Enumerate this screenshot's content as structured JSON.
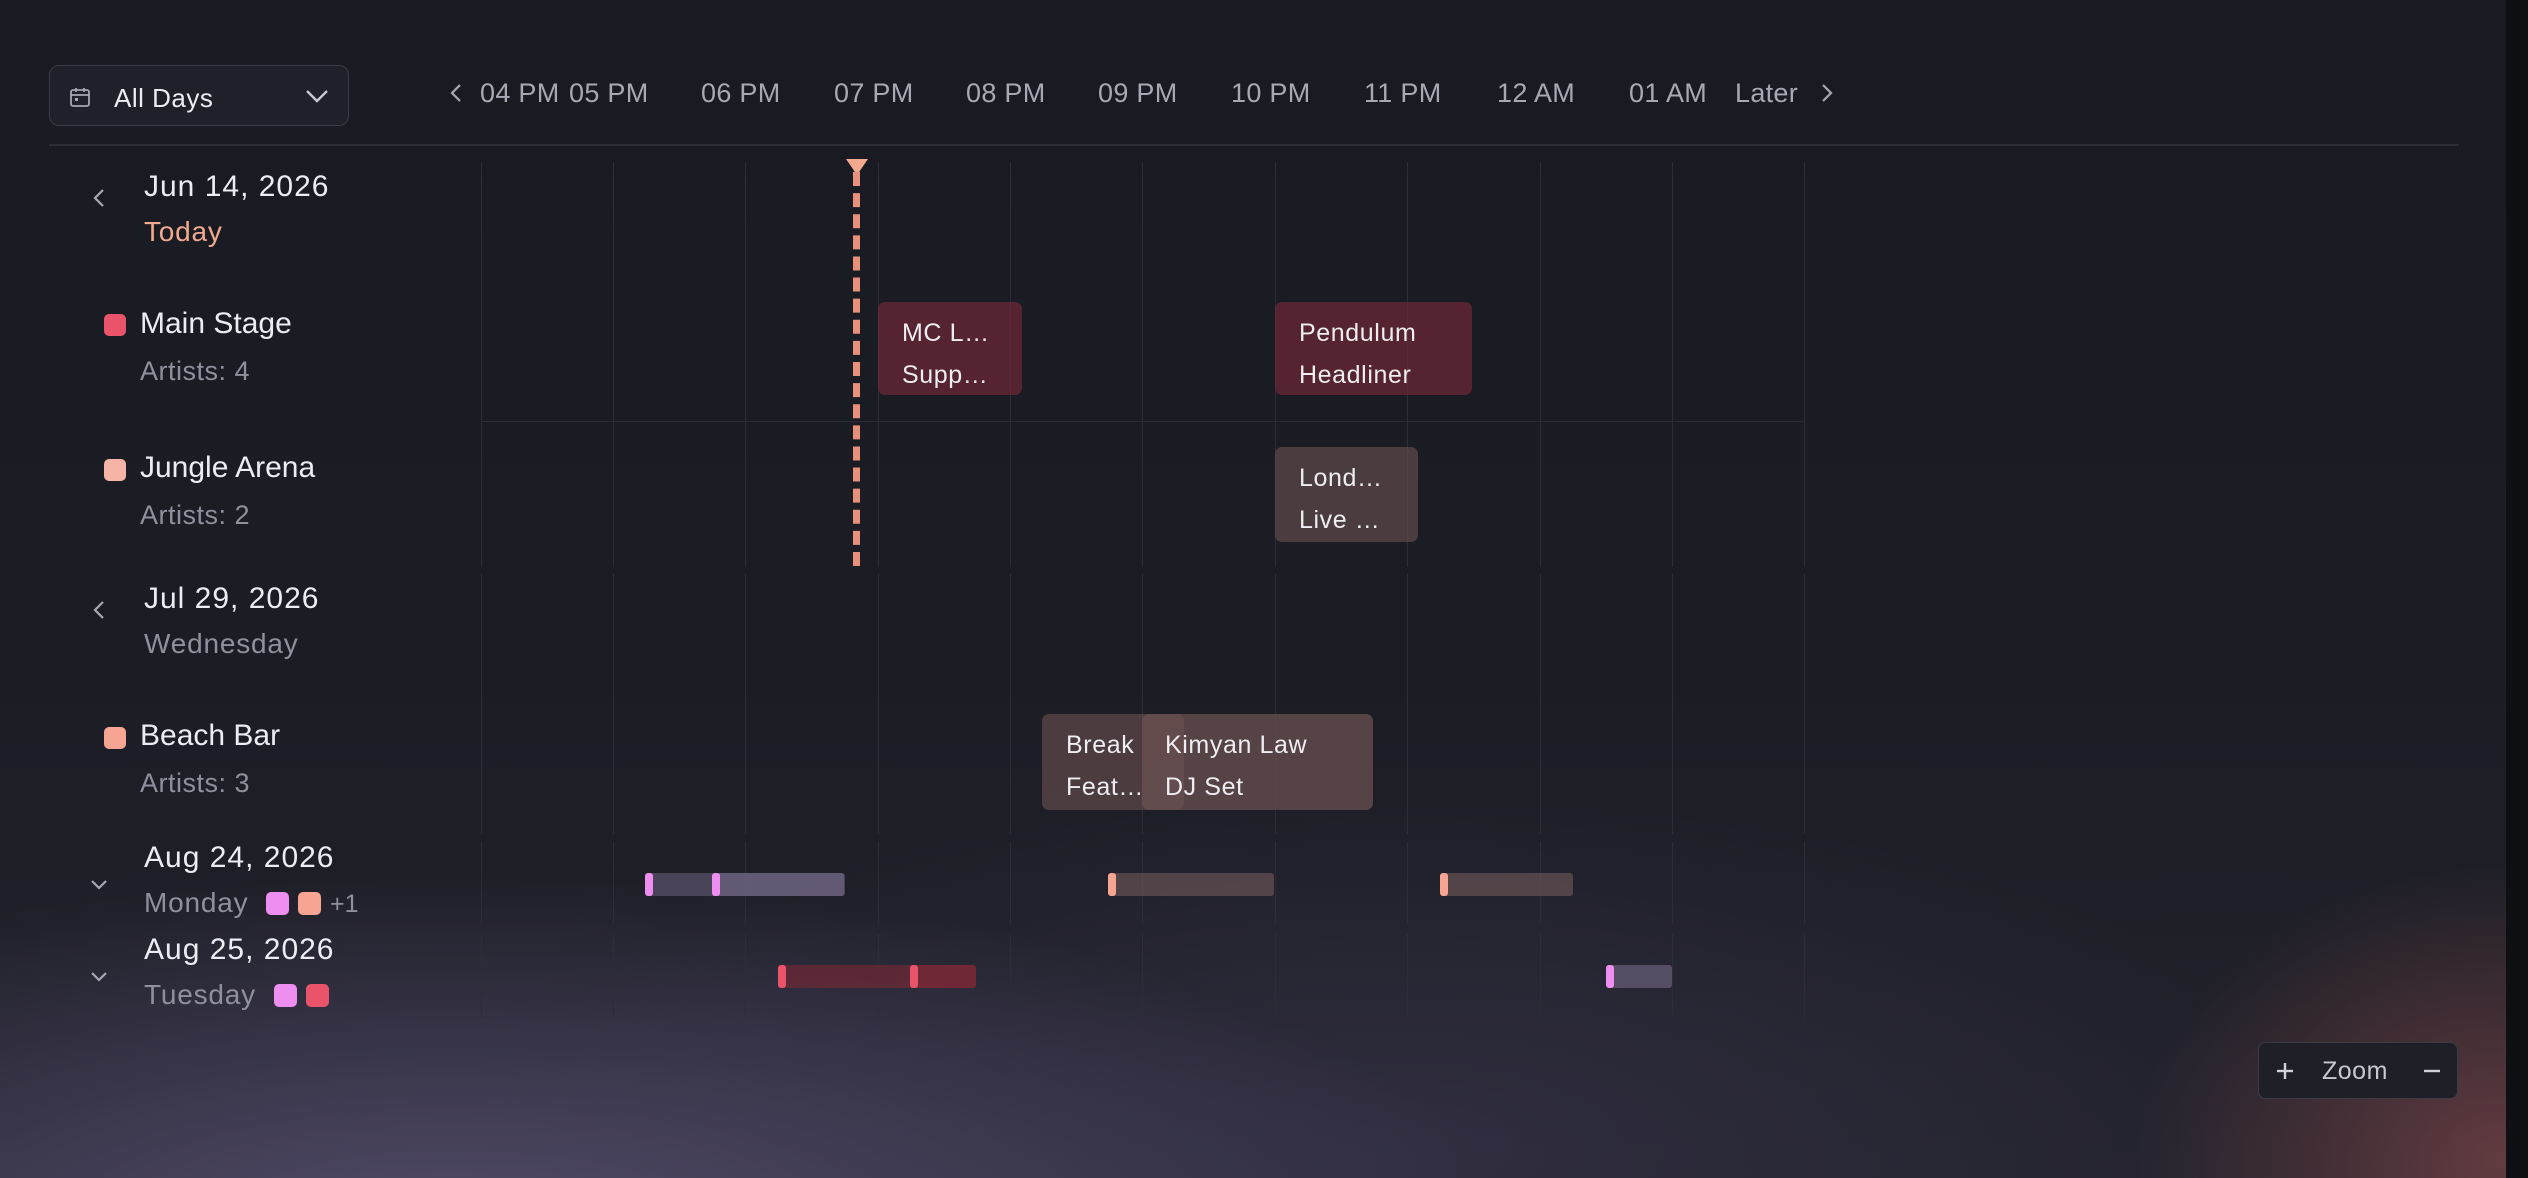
{
  "filter": {
    "label": "All Days",
    "icon": "calendar-icon"
  },
  "timeline": {
    "hours": [
      "04 PM",
      "05 PM",
      "06 PM",
      "07 PM",
      "08 PM",
      "09 PM",
      "10 PM",
      "11 PM",
      "12 AM",
      "01 AM"
    ],
    "later_label": "Later"
  },
  "days": [
    {
      "date": "Jun 14, 2026",
      "subtitle": "Today",
      "expanded": true,
      "stages": [
        {
          "name": "Main Stage",
          "count": "Artists: 4",
          "color": "#e9546b",
          "events": [
            {
              "line1": "MC L…",
              "line2": "Supp…"
            },
            {
              "line1": "Pendulum",
              "line2": "Headliner"
            }
          ]
        },
        {
          "name": "Jungle Arena",
          "count": "Artists: 2",
          "color": "#f6b4a6",
          "events": [
            {
              "line1": "Lond…",
              "line2": "Live …"
            }
          ]
        }
      ]
    },
    {
      "date": "Jul 29, 2026",
      "subtitle": "Wednesday",
      "expanded": true,
      "stages": [
        {
          "name": "Beach Bar",
          "count": "Artists: 3",
          "color": "#f5a592",
          "events": [
            {
              "line1": "Break",
              "line2": "Feat…"
            },
            {
              "line1": "Kimyan Law",
              "line2": "DJ Set"
            }
          ]
        }
      ]
    },
    {
      "date": "Aug 24, 2026",
      "subtitle": "Monday",
      "expanded": false,
      "more_label": "+1",
      "stage_colors": [
        "#ee8ef0",
        "#f5a592"
      ]
    },
    {
      "date": "Aug 25, 2026",
      "subtitle": "Tuesday",
      "expanded": false,
      "stage_colors": [
        "#ee8ef0",
        "#e9546b"
      ]
    }
  ],
  "colors": {
    "accent_now": "#f2a98e",
    "main_stage": "#e9546b",
    "jungle_arena": "#f6b4a6",
    "beach_bar": "#f5a592",
    "pink_stage": "#ee8ef0"
  },
  "zoom": {
    "label": "Zoom",
    "in_icon": "plus-icon",
    "out_icon": "minus-icon"
  }
}
